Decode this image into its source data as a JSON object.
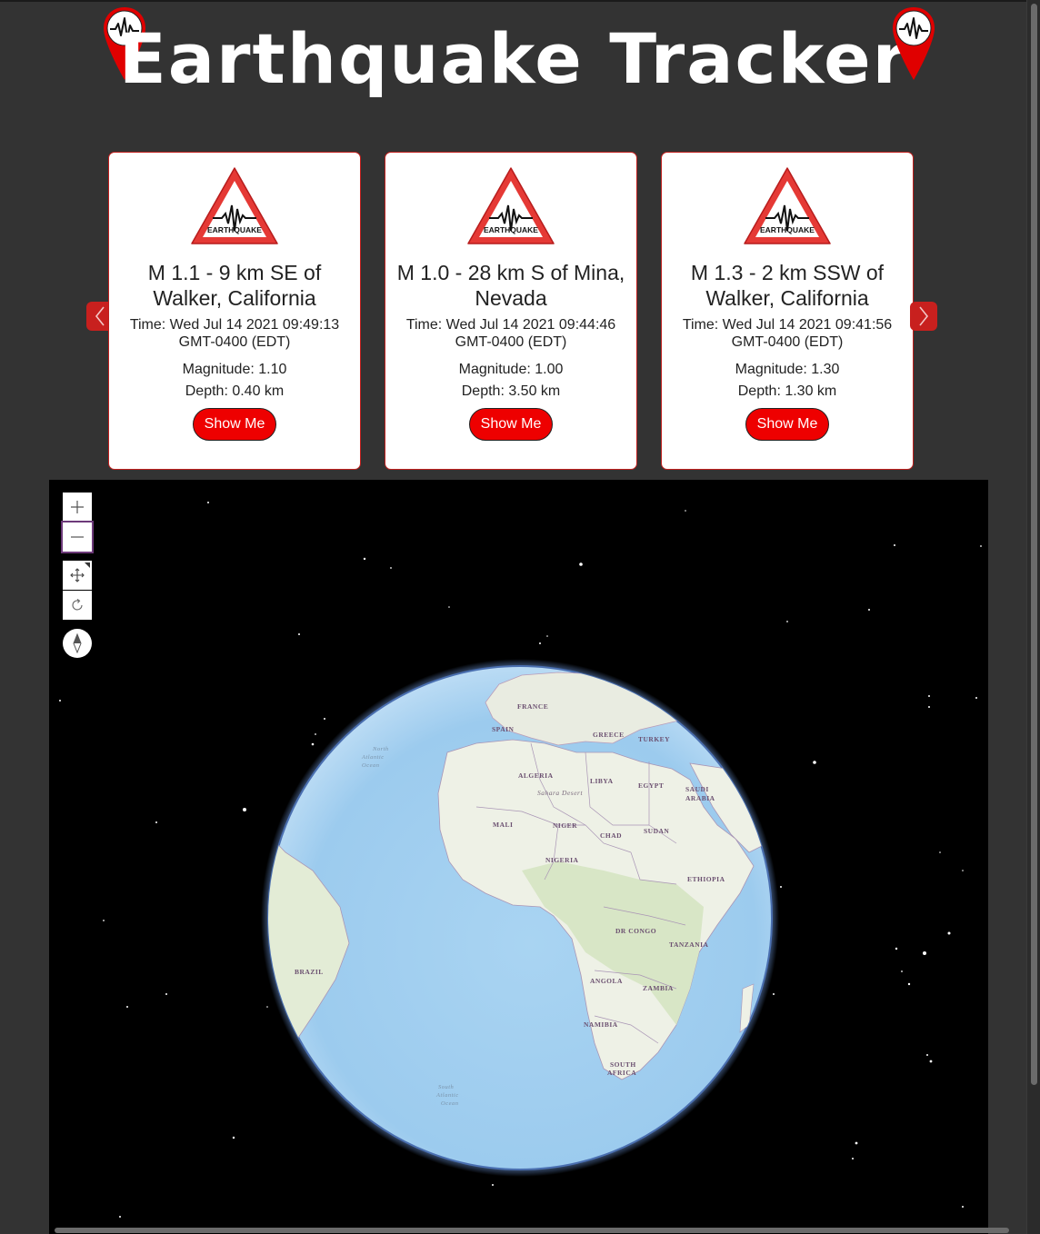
{
  "header": {
    "title": "Earthquake Tracker",
    "pin_icon": "seismic-pin-icon",
    "pin_color": "#e00000"
  },
  "carousel": {
    "prev_icon": "chevron-left-icon",
    "next_icon": "chevron-right-icon",
    "accent": "#c8201e",
    "sign_text": "EARTHQUAKE",
    "cards": [
      {
        "title": "M 1.1 - 9 km SE of Walker, California",
        "time": "Time: Wed Jul 14 2021 09:49:13 GMT-0400 (EDT)",
        "magnitude": "Magnitude: 1.10",
        "depth": "Depth: 0.40 km",
        "button": "Show Me"
      },
      {
        "title": "M 1.0 - 28 km S of Mina, Nevada",
        "time": "Time: Wed Jul 14 2021 09:44:46 GMT-0400 (EDT)",
        "magnitude": "Magnitude: 1.00",
        "depth": "Depth: 3.50 km",
        "button": "Show Me"
      },
      {
        "title": "M 1.3 - 2 km SSW of Walker, California",
        "time": "Time: Wed Jul 14 2021 09:41:56 GMT-0400 (EDT)",
        "magnitude": "Magnitude: 1.30",
        "depth": "Depth: 1.30 km",
        "button": "Show Me"
      }
    ]
  },
  "map": {
    "controls": [
      "zoom-in-icon",
      "zoom-out-icon",
      "pan-icon",
      "rotate-icon",
      "compass-icon"
    ],
    "labels": {
      "france": "FRANCE",
      "spain": "SPAIN",
      "greece": "GREECE",
      "turkey": "TURKEY",
      "algeria": "ALGERIA",
      "libya": "LIBYA",
      "egypt": "EGYPT",
      "saudi": "SAUDI",
      "arabia": "ARABIA",
      "sahara": "Sahara Desert",
      "mali": "MALI",
      "niger": "NIGER",
      "chad": "CHAD",
      "sudan": "SUDAN",
      "nigeria": "NIGERIA",
      "ethiopia": "ETHIOPIA",
      "drcongo": "DR CONGO",
      "tanzania": "TANZANIA",
      "angola": "ANGOLA",
      "zambia": "ZAMBIA",
      "namibia": "NAMIBIA",
      "south": "SOUTH",
      "africa": "AFRICA",
      "brazil": "BRAZIL",
      "north_atlantic": [
        "North",
        "Atlantic",
        "Ocean"
      ],
      "south_atlantic": [
        "South",
        "Atlantic",
        "Ocean"
      ]
    }
  }
}
